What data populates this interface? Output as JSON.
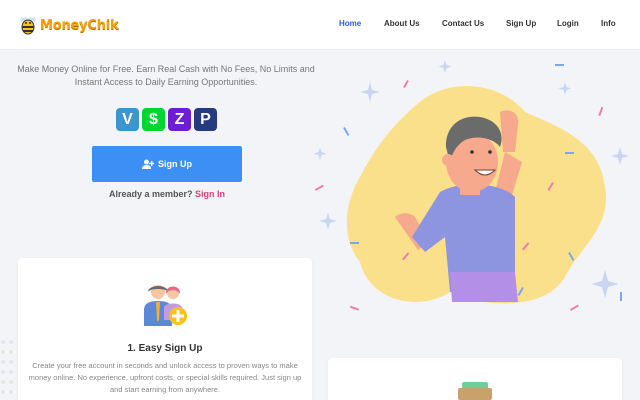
{
  "brand": {
    "name": "MoneyChik"
  },
  "nav": {
    "items": [
      {
        "label": "Home",
        "active": true
      },
      {
        "label": "About Us",
        "active": false
      },
      {
        "label": "Contact Us",
        "active": false
      },
      {
        "label": "Sign Up",
        "active": false
      },
      {
        "label": "Login",
        "active": false
      },
      {
        "label": "Info",
        "active": false
      }
    ]
  },
  "hero": {
    "tagline": "Make Money Online for Free. Earn Real Cash with No Fees, No Limits and Instant Access to Daily Earning Opportunities.",
    "payment_icons": [
      "venmo-icon",
      "cash-app-icon",
      "zelle-icon",
      "paypal-icon"
    ],
    "signup_label": "Sign Up",
    "member_text": "Already a member?",
    "signin_label": "Sign In"
  },
  "features": [
    {
      "title": "1. Easy Sign Up",
      "description": "Create your free account in seconds and unlock access to proven ways to make money online. No experience, upfront costs, or special skills required. Just sign up and start earning from anywhere."
    }
  ],
  "colors": {
    "accent": "#2b5fd8",
    "button": "#3b8ff5",
    "signin": "#e0407a",
    "brand": "#f2a20c"
  }
}
